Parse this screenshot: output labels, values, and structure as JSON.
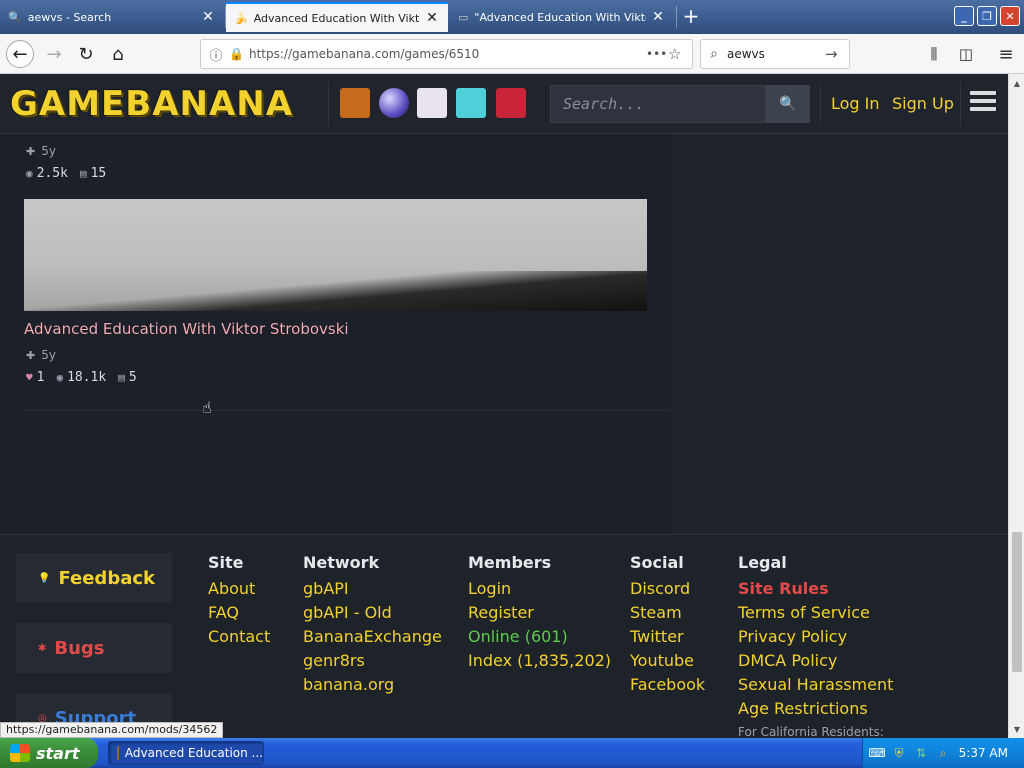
{
  "browser": {
    "tabs": [
      {
        "title": "aewvs - Search",
        "active": false
      },
      {
        "title": "Advanced Education With Viktor S",
        "active": true
      },
      {
        "title": "\"Advanced Education With Viktor",
        "active": false
      }
    ],
    "url": "https://gamebanana.com/games/6510",
    "search_query": "aewvs"
  },
  "site": {
    "logo_text": "GAMEBANANA",
    "search_placeholder": "Search...",
    "login_label": "Log In",
    "signup_label": "Sign Up"
  },
  "items": [
    {
      "age": "5y",
      "views": "2.5k",
      "posts": "15"
    },
    {
      "title": "Advanced Education With Viktor Strobovski",
      "age": "5y",
      "likes": "1",
      "views": "18.1k",
      "posts": "5"
    }
  ],
  "footer": {
    "feedback_label": "Feedback",
    "bugs_label": "Bugs",
    "support_label": "Support",
    "site": {
      "heading": "Site",
      "links": [
        "About",
        "FAQ",
        "Contact"
      ]
    },
    "network": {
      "heading": "Network",
      "links": [
        "gbAPI",
        "gbAPI - Old",
        "BananaExchange",
        "genr8rs",
        "banana.org"
      ]
    },
    "members": {
      "heading": "Members",
      "links": [
        "Login",
        "Register",
        "Online (601)",
        "Index (1,835,202)"
      ]
    },
    "social": {
      "heading": "Social",
      "links": [
        "Discord",
        "Steam",
        "Twitter",
        "Youtube",
        "Facebook"
      ]
    },
    "legal": {
      "heading": "Legal",
      "links": [
        "Site Rules",
        "Terms of Service",
        "Privacy Policy",
        "DMCA Policy",
        "Sexual Harassment",
        "Age Restrictions"
      ]
    },
    "california_note": "For California Residents:"
  },
  "status_url": "https://gamebanana.com/mods/34562",
  "taskbar": {
    "start_label": "start",
    "task_label": "Advanced Education ...",
    "clock": "5:37 AM"
  }
}
